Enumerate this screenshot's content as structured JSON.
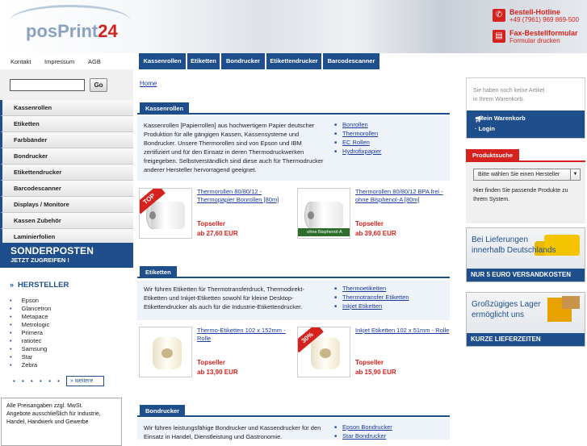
{
  "header": {
    "logo_text": "posPrint",
    "logo_num": "24",
    "hotline_label": "Bestell-Hotline",
    "hotline_number": "+49 (7961) 969 869-500",
    "fax_label": "Fax-Bestellformular",
    "fax_sub": "Formular drucken"
  },
  "toplinks": [
    "Kontakt",
    "Impressum",
    "AGB"
  ],
  "mainnav": [
    "Kassenrollen",
    "Etiketten",
    "Bondrucker",
    "Etikettendrucker",
    "Barcodescanner"
  ],
  "search": {
    "button_label": "Go",
    "value": ""
  },
  "categories": [
    "Kassenrollen",
    "Etiketten",
    "Farbbänder",
    "Bondrucker",
    "Etikettendrucker",
    "Barcodescanner",
    "Displays / Monitore",
    "Kassen Zubehör",
    "Laminierfolien"
  ],
  "sonder": {
    "line1": "SONDERPOSTEN",
    "line2": "JETZT ZUGREIFEN !"
  },
  "hersteller": {
    "title": "HERSTELLER",
    "items": [
      "Epson",
      "Glancetron",
      "Metapace",
      "Metrologic",
      "Primera",
      "ratiotec",
      "Samsung",
      "Star",
      "Zebra"
    ],
    "more_label": "» weitere"
  },
  "preis": {
    "line1": "Alle Preisangaben zzgl. MwSt.",
    "line2": "Angebote ausschließlich für Industrie, Handel, Handwerk und Gewerbe"
  },
  "breadcrumb": "Home",
  "sections": [
    {
      "title": "Kassenrollen",
      "desc": "Kassenrollen [Papierrollen] aus hochwertigem Papier deutscher Produktion für alle gängigen Kassen, Kassensysteme und Bondrucker. Unsere Thermorollen sind von Epson und IBM zertifiziert und für den Einsatz in deren Thermodruckwerken freigegeben. Selbstverständlich sind diese auch für Thermodrucker anderer Hersteller hervorragend geeignet.",
      "links": [
        "Bonrollen",
        "Thermorollen",
        "EC Rollen",
        "Hydrofixpapier"
      ],
      "products": [
        {
          "name": "Thermorollen 80/80/12 - Thermopapier Bonrollen [80m]",
          "badge": "TOP",
          "topseller": "Topseller",
          "price": "ab 27,60 EUR"
        },
        {
          "name": "Thermorollen 80/80/12 BPA frei - ohne Bisphenol-A [80m]",
          "badge": "ohne Bisphenol-A",
          "topseller": "Topseller",
          "price": "ab 39,60 EUR"
        }
      ]
    },
    {
      "title": "Etiketten",
      "desc": "Wir führen Etiketten für Thermotransferdruck, Thermodirekt-Etiketten und Inkjet-Etiketten sowohl für kleine Desktop-Etikettendrucker als auch für die Industrie-Etikettendrucker.",
      "links": [
        "Thermoetiketten",
        "Thermotransfer Etiketten",
        "Inkjet Etiketten"
      ],
      "products": [
        {
          "name": "Thermo-Etiketten 102 x 152mm - Rolle",
          "badge": "",
          "topseller": "Topseller",
          "price": "ab 13,90 EUR"
        },
        {
          "name": "Inkjet Etiketten 102 x 51mm - Rolle",
          "badge": "30%",
          "topseller": "Topseller",
          "price": "ab 15,90 EUR"
        }
      ]
    },
    {
      "title": "Bondrucker",
      "desc": "Wir führen leistungsfähige Bondrucker und Kassendrucker für den Einsatz in Handel, Dienstleistung und Gastronomie.",
      "links": [
        "Epson Bondrucker",
        "Star Bondrucker"
      ]
    }
  ],
  "cart": {
    "empty_text_1": "Sie haben noch keine Artikel",
    "empty_text_2": "in Ihrem Warenkorb.",
    "link1": "· Mein Warenkorb",
    "link2": "· Login"
  },
  "produktsuche": {
    "title": "Produktsuche",
    "select_value": "Bitte wählen Sie einen Hersteller",
    "hint": "Hier finden Sie passende Produkte zu Ihrem System."
  },
  "banners": [
    {
      "line1": "Bei Lieferungen",
      "line2": "innerhalb Deutschlands",
      "foot": "NUR 5 EURO VERSANDKOSTEN"
    },
    {
      "line1": "Großzügiges Lager",
      "line2": "ermöglicht uns",
      "foot": "KURZE LIEFERZEITEN"
    }
  ],
  "colors": {
    "brand_blue": "#1f4e8c",
    "accent_red": "#d6221e"
  }
}
